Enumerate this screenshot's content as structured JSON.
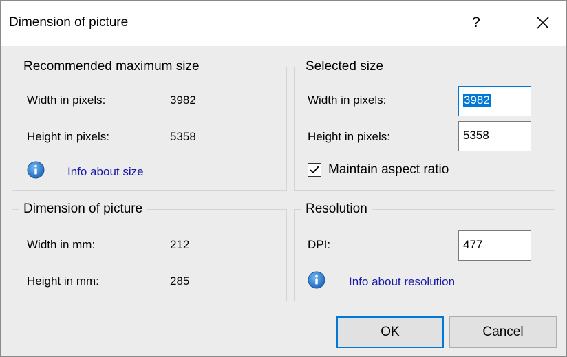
{
  "dialog": {
    "title": "Dimension of picture",
    "help": "?"
  },
  "recommended": {
    "legend": "Recommended maximum size",
    "width_label": "Width in pixels:",
    "width_value": "3982",
    "height_label": "Height in pixels:",
    "height_value": "5358",
    "info_link": "Info about size"
  },
  "selected": {
    "legend": "Selected size",
    "width_label": "Width in pixels:",
    "width_value": "3982",
    "height_label": "Height in pixels:",
    "height_value": "5358",
    "maintain_label": "Maintain aspect ratio",
    "maintain_checked": true
  },
  "dimension": {
    "legend": "Dimension of picture",
    "width_label": "Width in mm:",
    "width_value": "212",
    "height_label": "Height in mm:",
    "height_value": "285"
  },
  "resolution": {
    "legend": "Resolution",
    "dpi_label": "DPI:",
    "dpi_value": "477",
    "info_link": "Info about resolution"
  },
  "buttons": {
    "ok": "OK",
    "cancel": "Cancel"
  },
  "colors": {
    "accent": "#0078d7",
    "link": "#1a1aa6",
    "dialog_bg": "#ececec"
  },
  "icons": {
    "info": "info-icon",
    "close": "close-icon",
    "check": "checkmark-icon"
  }
}
